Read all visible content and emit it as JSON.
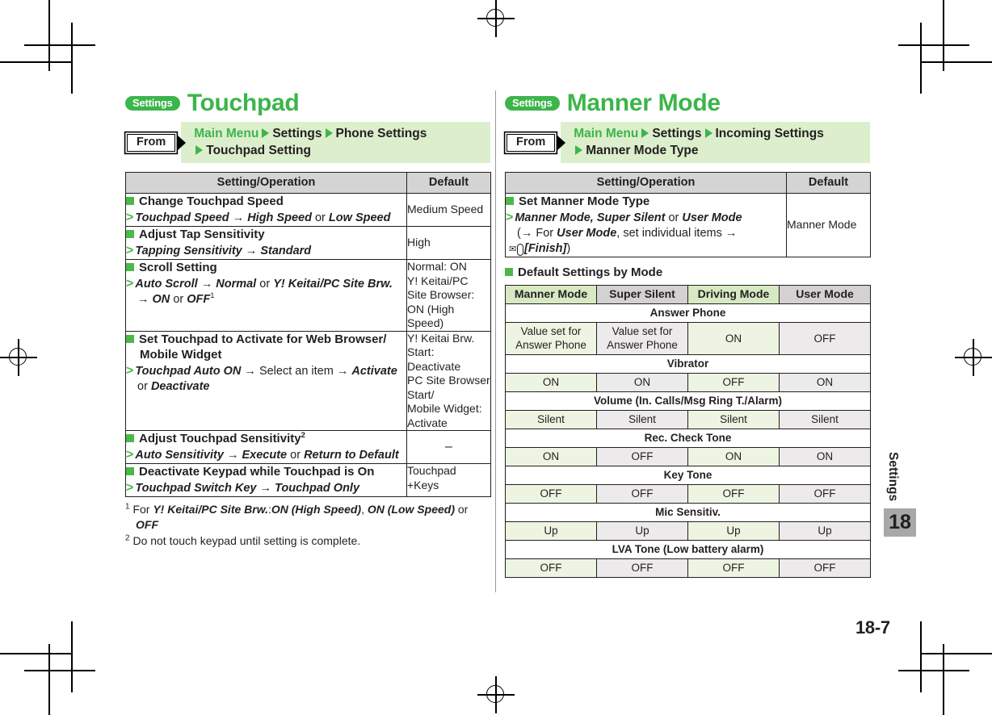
{
  "colors": {
    "brand_green": "#3cb54a",
    "marker_green": "#4cb848",
    "path_band": "#ddeecd",
    "header_gray": "#d4d4d4",
    "mode_head_green": "#d7e9c2",
    "mode_head_gray": "#d3d1d1",
    "mode_cell_green": "#edf5e2",
    "mode_cell_gray": "#eceaea",
    "chapter_tab_gray": "#a8a8a8"
  },
  "page": {
    "folio": "18-7",
    "chapter_label": "Settings",
    "chapter_number": "18"
  },
  "left": {
    "badge": "Settings",
    "title": "Touchpad",
    "from": {
      "label": "From",
      "line1": [
        "Main Menu",
        "Settings",
        "Phone Settings"
      ],
      "line2": [
        "Touchpad Setting"
      ]
    },
    "table": {
      "headers": [
        "Setting/Operation",
        "Default"
      ],
      "rows": [
        {
          "title": "Change Touchpad Speed",
          "step_html": "<span class=\"bi\">Touchpad Speed</span> <span class=\"arr\">→</span> <span class=\"bi\">High Speed</span> <span class=\"reg-t\">or</span> <span class=\"bi\">Low Speed</span>",
          "default": "Medium Speed",
          "default_align": "middle"
        },
        {
          "title": "Adjust Tap Sensitivity",
          "step_html": "<span class=\"bi\">Tapping Sensitivity</span> <span class=\"arr\">→</span> <span class=\"bi\">Standard</span>",
          "default": "High",
          "default_align": "middle"
        },
        {
          "title": "Scroll Setting",
          "step_html": "<span class=\"bi\">Auto Scroll</span> <span class=\"arr\">→</span> <span class=\"bi\">Normal</span> <span class=\"reg-t\">or</span> <span class=\"bi\">Y! Keitai/PC Site Brw.</span><br><span class=\"arr\">→</span> <span class=\"bi\">ON</span> <span class=\"reg-t\">or</span> <span class=\"bi\">OFF</span><sup>1</sup>",
          "default": "Normal: ON\nY! Keitai/PC\nSite Browser:\nON (High\nSpeed)",
          "default_align": "top"
        },
        {
          "title": "Set Touchpad to Activate for Web Browser/ Mobile Widget",
          "step_html": "<span class=\"bi\">Touchpad Auto ON</span> <span class=\"arr\">→</span> <span class=\"reg-t\">Select an item</span> <span class=\"arr\">→</span> <span class=\"bi\">Activate</span><br><span class=\"reg-t\">or</span> <span class=\"bi\">Deactivate</span>",
          "default": "Y! Keitai Brw.\nStart:\nDeactivate\nPC Site Browser\nStart/\nMobile Widget:\nActivate",
          "default_align": "top"
        },
        {
          "title": "Adjust Touchpad Sensitivity<sup>2</sup>",
          "step_html": "<span class=\"bi\">Auto Sensitivity</span> <span class=\"arr\">→</span> <span class=\"bi\">Execute</span> <span class=\"reg-t\">or</span> <span class=\"bi\">Return to Default</span>",
          "default": "–",
          "default_align": "dash"
        },
        {
          "title": "Deactivate Keypad while Touchpad is On",
          "step_html": "<span class=\"bi\">Touchpad Switch Key</span> <span class=\"arr\">→</span> <span class=\"bi\">Touchpad Only</span>",
          "default": "Touchpad\n+Keys",
          "default_align": "top"
        }
      ]
    },
    "footnotes": [
      {
        "marker": "1",
        "html": "For <span class=\"bi\">Y! Keitai/PC Site Brw.</span>:<span class=\"bi\">ON (High Speed)</span>, <span class=\"bi\">ON (Low Speed)</span> or <span class=\"bi\">OFF</span>"
      },
      {
        "marker": "2",
        "html": "Do not touch keypad until setting is complete."
      }
    ]
  },
  "right": {
    "badge": "Settings",
    "title": "Manner Mode",
    "from": {
      "label": "From",
      "line1": [
        "Main Menu",
        "Settings",
        "Incoming Settings"
      ],
      "line2": [
        "Manner Mode Type"
      ]
    },
    "table": {
      "headers": [
        "Setting/Operation",
        "Default"
      ],
      "rows": [
        {
          "title": "Set Manner Mode Type",
          "step_html": "<span class=\"bi\">Manner Mode, Super Silent</span> <span class=\"reg-t\">or</span> <span class=\"bi\">User Mode</span><br><span class=\"reg-t\">(</span><span class=\"arr\">→</span> <span class=\"reg-t\">For</span> <span class=\"bi\">User Mode</span><span class=\"reg-t\">, set individual items</span> <span class=\"arr\">→</span><br><span class=\"envkey\">✉</span><span class=\"bi\">[Finish]</span><span class=\"reg-t\">)</span>",
          "default": "Manner Mode",
          "default_align": "middle"
        }
      ]
    },
    "subhead": "Default Settings by Mode",
    "modes": {
      "columns": [
        "Manner Mode",
        "Super Silent",
        "Driving Mode",
        "User Mode"
      ],
      "groups": [
        {
          "label": "Answer Phone",
          "values": [
            "Value set for Answer Phone",
            "Value set for Answer Phone",
            "ON",
            "OFF"
          ]
        },
        {
          "label": "Vibrator",
          "values": [
            "ON",
            "ON",
            "OFF",
            "ON"
          ]
        },
        {
          "label": "Volume (In. Calls/Msg Ring T./Alarm)",
          "values": [
            "Silent",
            "Silent",
            "Silent",
            "Silent"
          ]
        },
        {
          "label": "Rec. Check Tone",
          "values": [
            "ON",
            "OFF",
            "ON",
            "ON"
          ]
        },
        {
          "label": "Key Tone",
          "values": [
            "OFF",
            "OFF",
            "OFF",
            "OFF"
          ]
        },
        {
          "label": "Mic Sensitiv.",
          "values": [
            "Up",
            "Up",
            "Up",
            "Up"
          ]
        },
        {
          "label": "LVA Tone (Low battery alarm)",
          "values": [
            "OFF",
            "OFF",
            "OFF",
            "OFF"
          ]
        }
      ]
    }
  }
}
